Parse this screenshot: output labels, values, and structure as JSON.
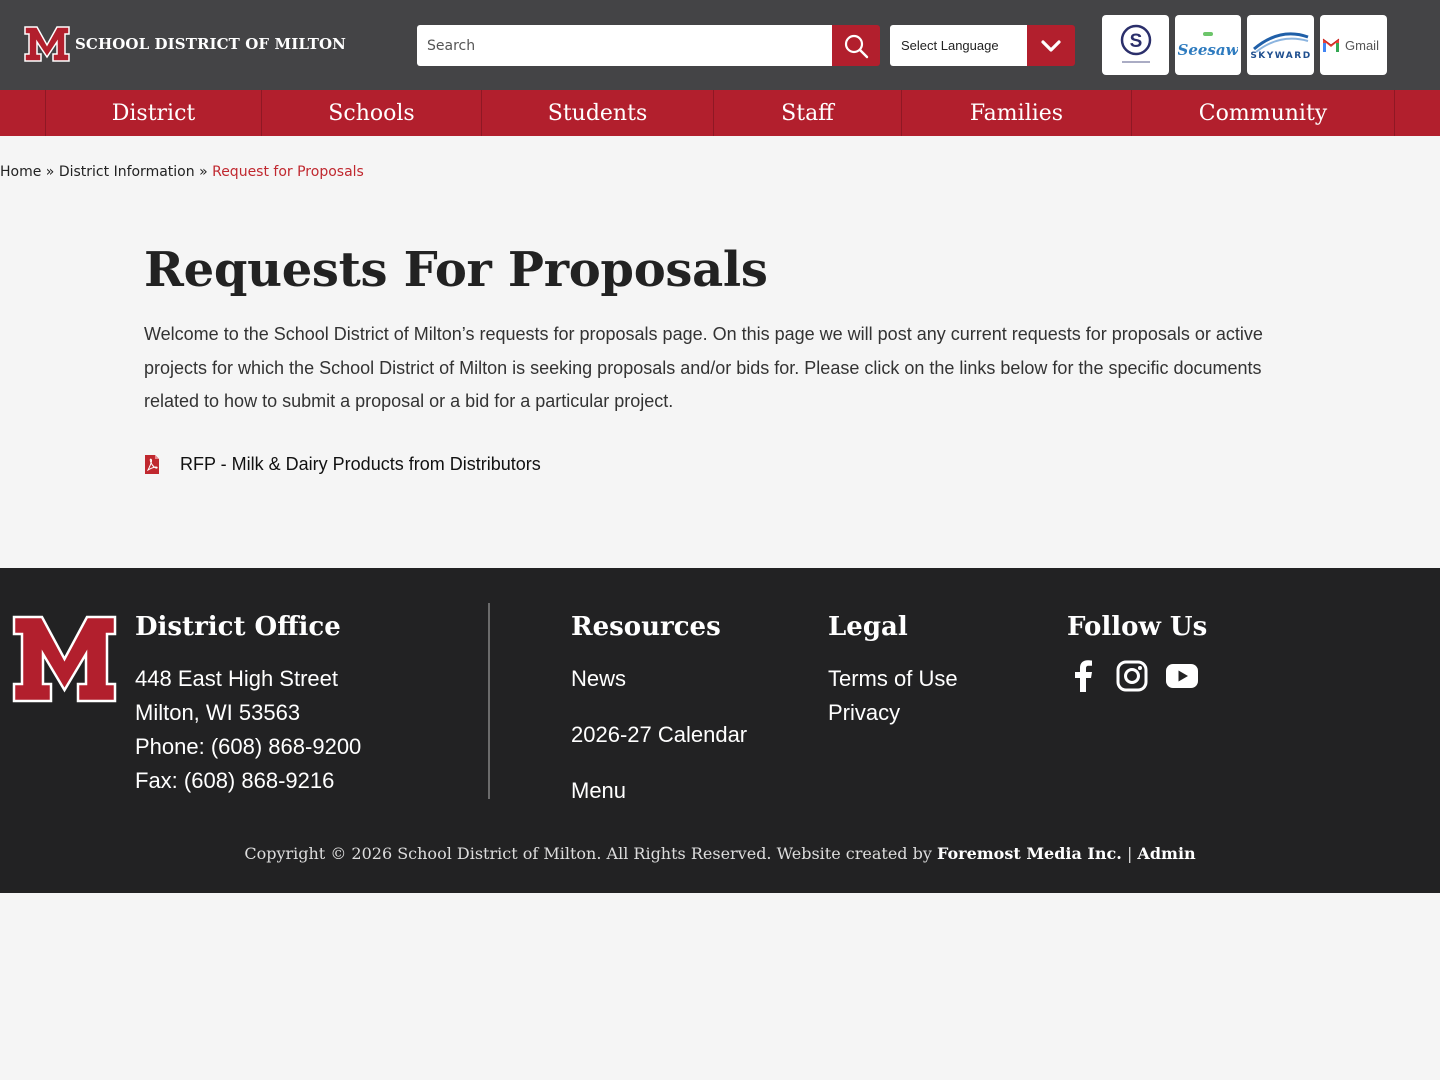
{
  "header": {
    "site_name": "SCHOOL DISTRICT OF MILTON",
    "search_placeholder": "Search",
    "language_label": "Select Language",
    "quick_links": [
      "Schoology",
      "Seesaw",
      "Skyward",
      "Gmail"
    ]
  },
  "nav": {
    "items": [
      "District",
      "Schools",
      "Students",
      "Staff",
      "Families",
      "Community"
    ]
  },
  "breadcrumb": {
    "home": "Home",
    "sep1": "»",
    "parent": "District Information",
    "sep2": "»",
    "current": "Request for Proposals"
  },
  "main": {
    "title": "Requests For Proposals",
    "intro": "Welcome to the School District of Milton’s requests for proposals page.  On this page we will post any current requests for proposals or active projects for which the School District of Milton is seeking proposals and/or bids for.  Please click on the links below for the specific documents related to how to submit a proposal or a bid for a particular project.",
    "documents": [
      "RFP - Milk & Dairy Products from Distributors"
    ]
  },
  "footer": {
    "office": {
      "heading": "District Office",
      "street": "448 East High Street",
      "city": "Milton, WI 53563",
      "phone": "Phone: (608) 868-9200",
      "fax": "Fax: (608) 868-9216"
    },
    "resources": {
      "heading": "Resources",
      "links": [
        "News",
        "2026-27 Calendar",
        "Menu"
      ]
    },
    "legal": {
      "heading": "Legal",
      "links": [
        "Terms of Use",
        "Privacy"
      ]
    },
    "follow": {
      "heading": "Follow Us",
      "icons": [
        "facebook-icon",
        "instagram-icon",
        "youtube-icon"
      ]
    },
    "copyright_text": "Copyright © 2026 School District of Milton. All Rights Reserved. Website created by",
    "creator": "Foremost Media Inc.",
    "pipe": "|",
    "admin": "Admin"
  },
  "colors": {
    "brand_red": "#b21f2d",
    "header_gray": "#444446",
    "footer_dark": "#222223",
    "breadcrumb_current": "#c0282f"
  }
}
